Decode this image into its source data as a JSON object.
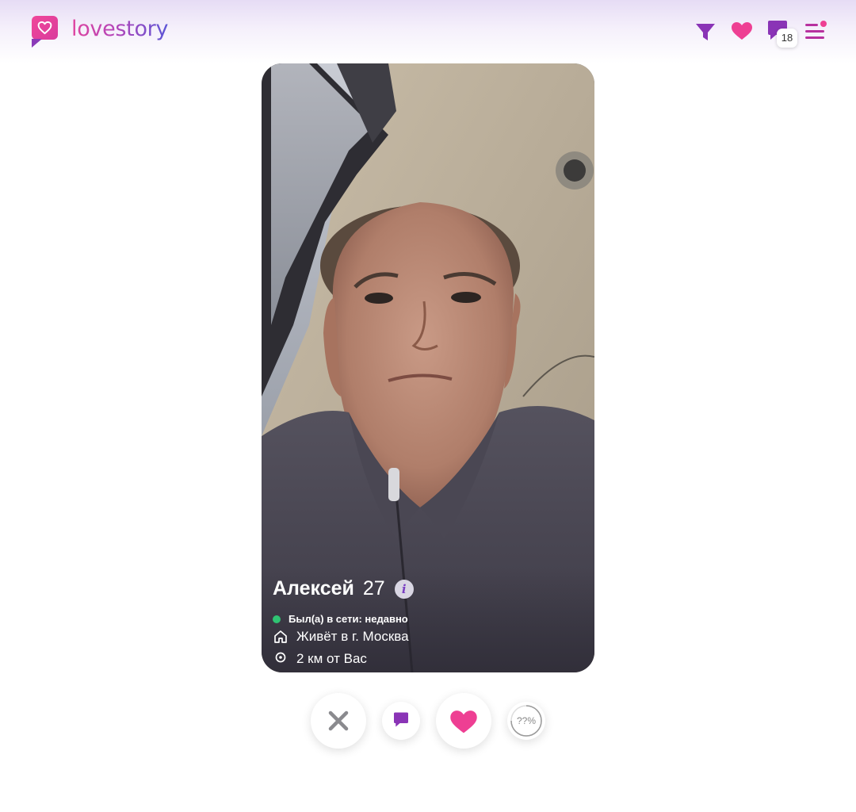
{
  "header": {
    "logo_text": "lovestory",
    "messages_badge": "18"
  },
  "profile": {
    "name": "Алексей",
    "age": "27",
    "info_icon": "i",
    "status": "Был(а) в сети: недавно",
    "city": "Живёт в г. Москва",
    "distance": "2 км от Вас"
  },
  "actions": {
    "match_percent": "??%"
  },
  "colors": {
    "brand_pink": "#ee3f93",
    "brand_purple": "#8b3ab8",
    "online_green": "#2fc473"
  },
  "icons": [
    "heart-logo-icon",
    "filter-icon",
    "heart-icon",
    "chat-icon",
    "menu-icon",
    "info-icon",
    "home-icon",
    "location-pin-icon",
    "close-icon",
    "match-progress-icon"
  ]
}
